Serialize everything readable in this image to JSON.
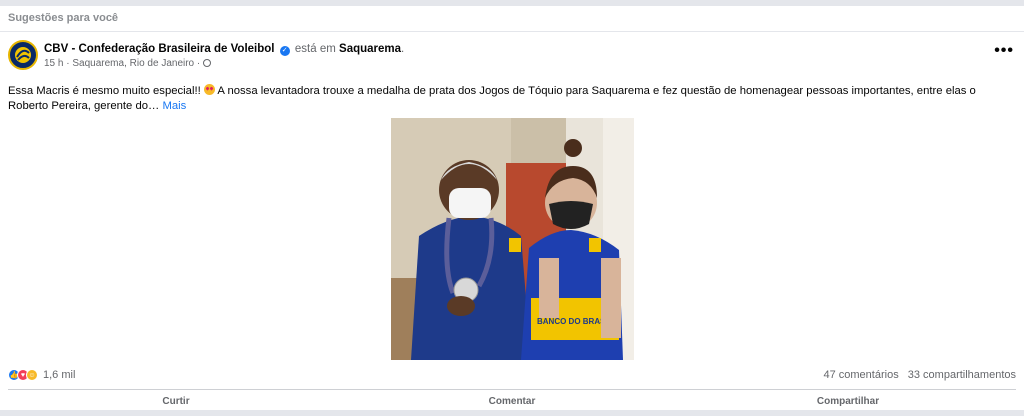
{
  "section": {
    "title": "Sugestões para você"
  },
  "post": {
    "author": "CBV - Confederação Brasileira de Voleibol",
    "verified_mark": "✓",
    "is_at_label": "está em",
    "place": "Saquarema",
    "time": "15 h",
    "location": "Saquarema, Rio de Janeiro",
    "meta_separator": "·",
    "more_options": "•••",
    "text_part1": "Essa Macris é mesmo muito especial!!",
    "text_part2": "A nossa levantadora trouxe a medalha de prata dos Jogos de Tóquio para Saquarema e fez questão de homenagear pessoas importantes, entre elas o Roberto Pereira, gerente do…",
    "more_link": "Mais",
    "jersey_text": "BANCO DO BRASIL"
  },
  "engagement": {
    "reaction_count": "1,6 mil",
    "comments": "47 comentários",
    "shares": "33 compartilhamentos"
  },
  "actions": {
    "like": "Curtir",
    "comment": "Comentar",
    "share": "Compartilhar"
  },
  "icons": {
    "avatar": "cbv-logo-icon",
    "verified": "verified-badge-icon",
    "globe": "globe-icon",
    "reactions": [
      "like-reaction-icon",
      "love-reaction-icon",
      "care-reaction-icon"
    ]
  },
  "colors": {
    "link": "#1877f2",
    "muted": "#65676b",
    "jersey_blue": "#1d3a8a",
    "jersey_yellow": "#f2c400"
  }
}
